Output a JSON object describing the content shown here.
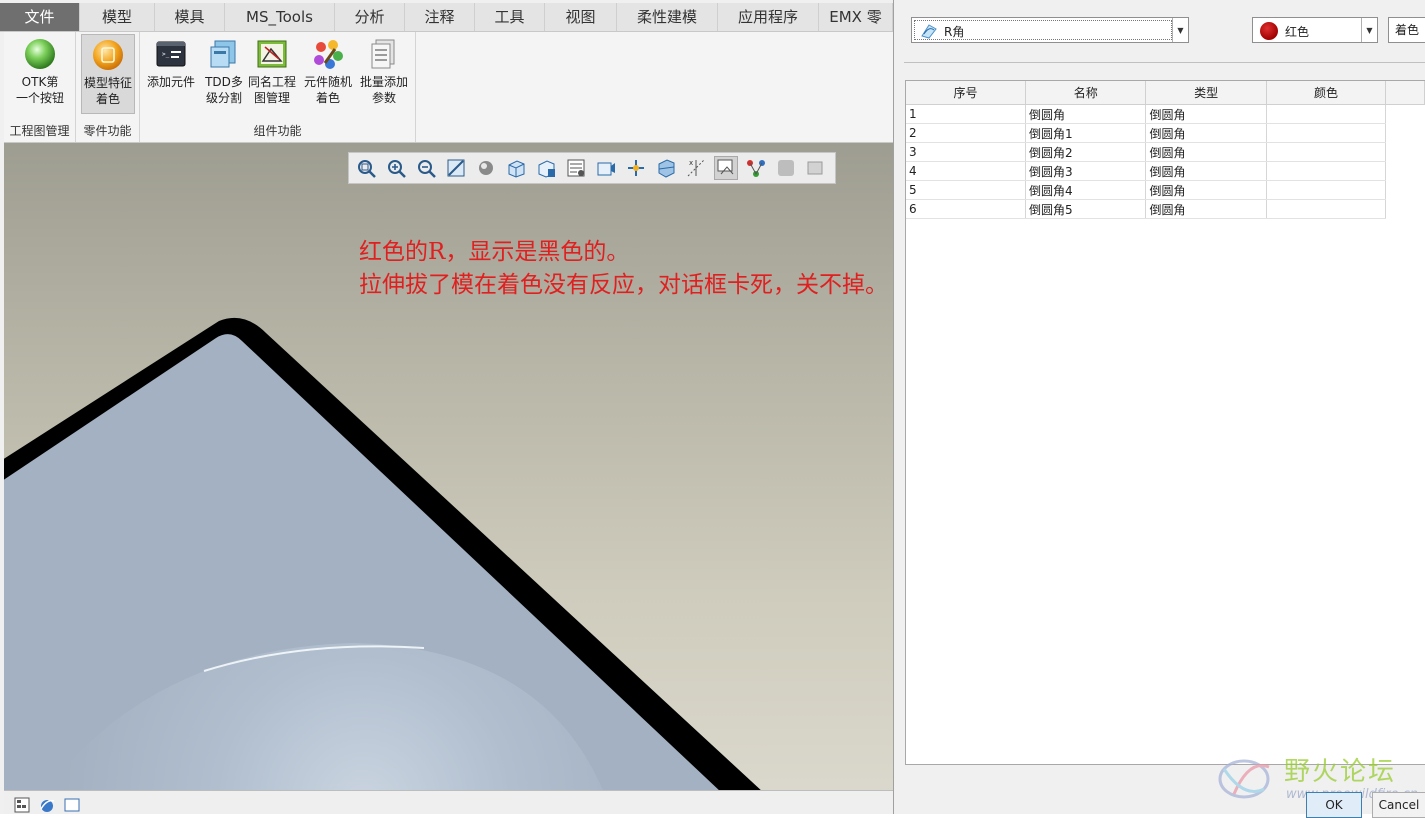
{
  "menubar": {
    "tabs": [
      {
        "label": "文件",
        "width": 80,
        "active": true
      },
      {
        "label": "模型",
        "width": 75
      },
      {
        "label": "模具",
        "width": 70
      },
      {
        "label": "MS_Tools",
        "width": 110
      },
      {
        "label": "分析",
        "width": 70
      },
      {
        "label": "注释",
        "width": 70
      },
      {
        "label": "工具",
        "width": 70
      },
      {
        "label": "视图",
        "width": 72
      },
      {
        "label": "柔性建模",
        "width": 101
      },
      {
        "label": "应用程序",
        "width": 101
      },
      {
        "label": "EMX 零",
        "width": 74
      }
    ]
  },
  "ribbon": {
    "groups": {
      "drawing_mgmt": "工程图管理",
      "part_functions": "零件功能",
      "assembly_functions": "组件功能"
    },
    "buttons": {
      "otk_first": "OTK第\n一个按钮",
      "feature_coloring": "模型特征\n着色",
      "add_component": "添加元件",
      "tdd_split": "TDD多\n级分割",
      "same_name_drawing": "同名工程\n图管理",
      "random_color": "元件随机\n着色",
      "batch_param": "批量添加\n参数"
    }
  },
  "annotation": {
    "line1": "红色的R，显示是黑色的。",
    "line2": "拉伸拔了模在着色没有反应，对话框卡死，关不掉。"
  },
  "dialog": {
    "feature_select": "R角",
    "color_select": "红色",
    "apply_label": "着色",
    "table": {
      "headers": [
        "序号",
        "名称",
        "类型",
        "颜色"
      ],
      "rows": [
        [
          "1",
          "倒圆角",
          "倒圆角",
          ""
        ],
        [
          "2",
          "倒圆角1",
          "倒圆角",
          ""
        ],
        [
          "3",
          "倒圆角2",
          "倒圆角",
          ""
        ],
        [
          "4",
          "倒圆角3",
          "倒圆角",
          ""
        ],
        [
          "5",
          "倒圆角4",
          "倒圆角",
          ""
        ],
        [
          "6",
          "倒圆角5",
          "倒圆角",
          ""
        ]
      ]
    },
    "ok_label": "OK",
    "cancel_label": "Cancel"
  },
  "watermark": {
    "title": "野火论坛",
    "url": "www.proewildfire.cn"
  },
  "colors": {
    "active_tab": "#6f6f6f",
    "annotation_red": "#e02020",
    "model_surface": "#a3b1c2",
    "model_edge": "#000000",
    "selected_color_swatch": "#c01010"
  },
  "view_toolbar": {
    "icons": [
      "refit-icon",
      "zoom-in-icon",
      "zoom-out-icon",
      "repaint-icon",
      "display-style-icon",
      "standard-orientation-icon",
      "saved-orientations-icon",
      "view-manager-icon",
      "perspective-icon",
      "spin-center-icon",
      "section-icon",
      "datum-display-icon",
      "annotation-display-icon",
      "model-tree-flow-icon",
      "appearance-icon",
      "shading-icon"
    ]
  }
}
